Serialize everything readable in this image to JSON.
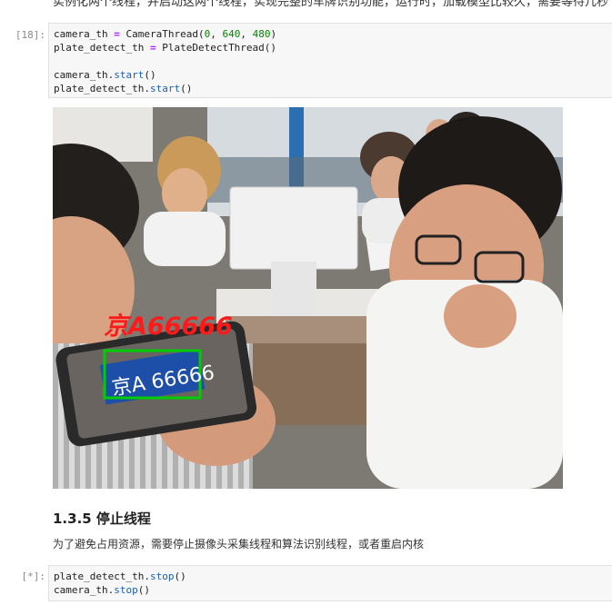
{
  "intro_text": "实例化两个线程，并启动这两个线程，实现完整的车牌识别功能，运行时，加载模型比较久，需要等待几秒",
  "cell1": {
    "prompt": "[18]:",
    "lines": [
      [
        {
          "t": "camera_th ",
          "c": "plain"
        },
        {
          "t": "=",
          "c": "op"
        },
        {
          "t": " CameraThread(",
          "c": "plain"
        },
        {
          "t": "0",
          "c": "num"
        },
        {
          "t": ", ",
          "c": "plain"
        },
        {
          "t": "640",
          "c": "num"
        },
        {
          "t": ", ",
          "c": "plain"
        },
        {
          "t": "480",
          "c": "num"
        },
        {
          "t": ")",
          "c": "plain"
        }
      ],
      [
        {
          "t": "plate_detect_th ",
          "c": "plain"
        },
        {
          "t": "=",
          "c": "op"
        },
        {
          "t": " PlateDetectThread()",
          "c": "plain"
        }
      ],
      [],
      [
        {
          "t": "camera_th.",
          "c": "plain"
        },
        {
          "t": "start",
          "c": "fn"
        },
        {
          "t": "()",
          "c": "plain"
        }
      ],
      [
        {
          "t": "plate_detect_th.",
          "c": "plain"
        },
        {
          "t": "start",
          "c": "fn"
        },
        {
          "t": "()",
          "c": "plain"
        }
      ]
    ]
  },
  "output_image": {
    "detected_plate_label": "京A66666",
    "plate_text": "京A 66666",
    "box_color": "#00cc00",
    "label_color": "#ff1a1a"
  },
  "section": {
    "heading": "1.3.5 停止线程",
    "paragraph": "为了避免占用资源，需要停止摄像头采集线程和算法识别线程，或者重启内核"
  },
  "cell2": {
    "prompt": "[*]:",
    "lines": [
      [
        {
          "t": "plate_detect_th.",
          "c": "plain"
        },
        {
          "t": "stop",
          "c": "fn"
        },
        {
          "t": "()",
          "c": "plain"
        }
      ],
      [
        {
          "t": "camera_th.",
          "c": "plain"
        },
        {
          "t": "stop",
          "c": "fn"
        },
        {
          "t": "()",
          "c": "plain"
        }
      ]
    ]
  }
}
